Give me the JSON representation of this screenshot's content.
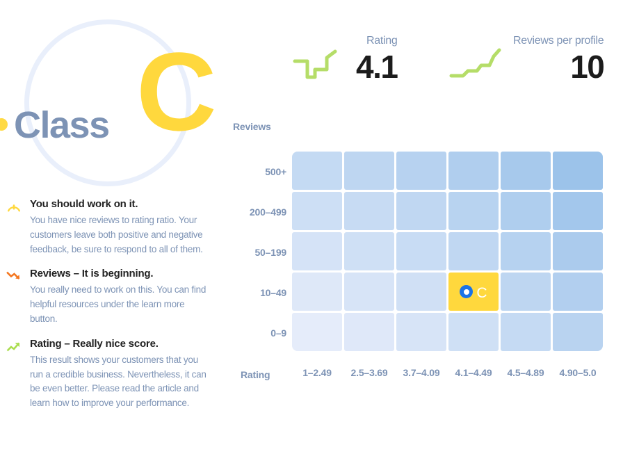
{
  "badge": {
    "word": "Class",
    "letter": "C",
    "dot_color": "#ffda44",
    "letter_color": "#ffd83d",
    "word_color": "#7d93b5"
  },
  "metrics": [
    {
      "id": "rating",
      "label": "Rating",
      "value": "4.1",
      "spark_icon": "sparkline-icon",
      "spark_color": "#b5dd68"
    },
    {
      "id": "reviews-per-profile",
      "label": "Reviews per profile",
      "value": "10",
      "spark_icon": "sparkline-icon",
      "spark_color": "#b5dd68"
    }
  ],
  "advice": [
    {
      "id": "work-on-it",
      "icon": "gauge-icon",
      "icon_color": "#ffd83d",
      "title": "You should work on it.",
      "body": "You have nice reviews to rating ratio. Your customers leave both positive and negative feedback, be sure to respond to all of them."
    },
    {
      "id": "reviews",
      "icon": "trend-down-icon",
      "icon_color": "#f4761f",
      "title": "Reviews – It is beginning.",
      "body": "You really need to work on this. You can find helpful resources under the learn more button."
    },
    {
      "id": "rating",
      "icon": "trend-up-icon",
      "icon_color": "#aadd4e",
      "title": "Rating – Really nice score.",
      "body": "This result shows your customers that you run a credible business. Nevertheless, it can be even better. Please read the article and learn how to improve your performance."
    }
  ],
  "chart_data": {
    "type": "heatmap",
    "title": "",
    "xlabel": "Rating",
    "ylabel": "Reviews",
    "x_categories": [
      "1–2.49",
      "2.5–3.69",
      "3.7–4.09",
      "4.1–4.49",
      "4.5–4.89",
      "4.90–5.0"
    ],
    "y_categories": [
      "500+",
      "200–499",
      "50–199",
      "10–49",
      "0–9"
    ],
    "grid": true,
    "legend": "none",
    "colors": {
      "low": "#e5ecfa",
      "high": "#9cc3ea",
      "active": "#ffd83d",
      "marker_ring": "#1a73e8",
      "marker_center": "#ffffff",
      "marker_label_color": "#ffffff"
    },
    "active_cell": {
      "row": "10–49",
      "column": "4.1–4.49",
      "row_index": 3,
      "column_index": 3,
      "label": "C",
      "marker": "class-position-marker"
    },
    "values": [
      [
        0.48,
        0.55,
        0.62,
        0.7,
        0.8,
        0.92
      ],
      [
        0.38,
        0.45,
        0.53,
        0.61,
        0.71,
        0.84
      ],
      [
        0.29,
        0.36,
        0.44,
        0.53,
        0.63,
        0.76
      ],
      [
        0.2,
        0.27,
        0.35,
        0.44,
        0.55,
        0.68
      ],
      [
        0.12,
        0.19,
        0.27,
        0.36,
        0.47,
        0.6
      ]
    ]
  }
}
